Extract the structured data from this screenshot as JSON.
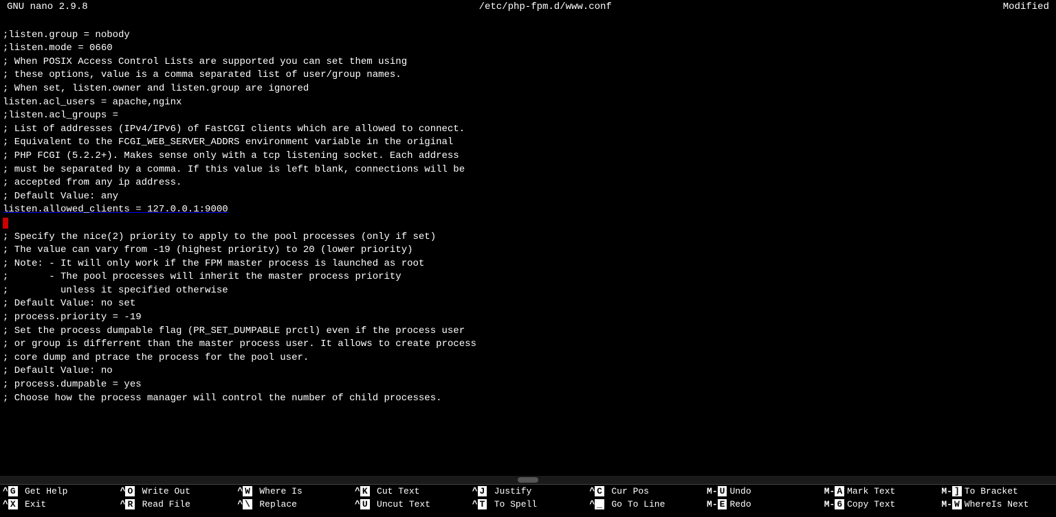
{
  "titleBar": {
    "left": "GNU nano 2.9.8",
    "center": "/etc/php-fpm.d/www.conf",
    "right": "Modified"
  },
  "editorContent": [
    ";listen.group = nobody",
    ";listen.mode = 0660",
    "",
    "; When POSIX Access Control Lists are supported you can set them using",
    "; these options, value is a comma separated list of user/group names.",
    "; When set, listen.owner and listen.group are ignored",
    "listen.acl_users = apache,nginx",
    ";listen.acl_groups =",
    "",
    "; List of addresses (IPv4/IPv6) of FastCGI clients which are allowed to connect.",
    "; Equivalent to the FCGI_WEB_SERVER_ADDRS environment variable in the original",
    "; PHP FCGI (5.2.2+). Makes sense only with a tcp listening socket. Each address",
    "; must be separated by a comma. If this value is left blank, connections will be",
    "; accepted from any ip address.",
    "; Default Value: any",
    "listen.allowed_clients = 127.0.0.1:9000",
    "",
    "; Specify the nice(2) priority to apply to the pool processes (only if set)",
    "; The value can vary from -19 (highest priority) to 20 (lower priority)",
    "; Note: - It will only work if the FPM master process is launched as root",
    ";       - The pool processes will inherit the master process priority",
    ";         unless it specified otherwise",
    "; Default Value: no set",
    "; process.priority = -19",
    "",
    "; Set the process dumpable flag (PR_SET_DUMPABLE prctl) even if the process user",
    "; or group is differrent than the master process user. It allows to create process",
    "; core dump and ptrace the process for the pool user.",
    "; Default Value: no",
    "; process.dumpable = yes",
    "",
    "; Choose how the process manager will control the number of child processes."
  ],
  "cursorLineIndex": 16,
  "shortcuts": {
    "row1": [
      {
        "key": "^G",
        "label": "Get Help"
      },
      {
        "key": "^O",
        "label": "Write Out"
      },
      {
        "key": "^W",
        "label": "Where Is"
      },
      {
        "key": "^K",
        "label": "Cut Text"
      },
      {
        "key": "^J",
        "label": "Justify"
      },
      {
        "key": "^C",
        "label": "Cur Pos"
      },
      {
        "key": "M-U",
        "label": "Undo"
      },
      {
        "key": "M-A",
        "label": "Mark Text"
      },
      {
        "key": "M-]",
        "label": "To Bracket"
      }
    ],
    "row2": [
      {
        "key": "^X",
        "label": "Exit"
      },
      {
        "key": "^R",
        "label": "Read File"
      },
      {
        "key": "^\\",
        "label": "Replace"
      },
      {
        "key": "^U",
        "label": "Uncut Text"
      },
      {
        "key": "^T",
        "label": "To Spell"
      },
      {
        "key": "^_",
        "label": "Go To Line"
      },
      {
        "key": "M-E",
        "label": "Redo"
      },
      {
        "key": "M-6",
        "label": "Copy Text"
      },
      {
        "key": "M-W",
        "label": "WhereIs Next"
      }
    ]
  },
  "statusBar": {
    "text": ""
  }
}
